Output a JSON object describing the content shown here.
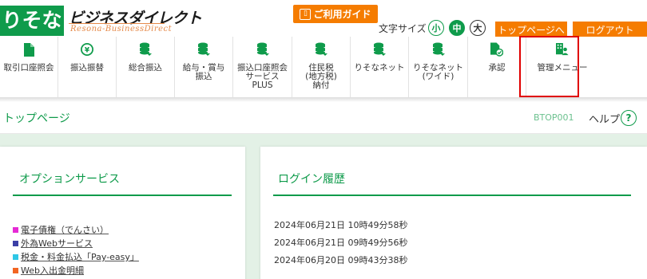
{
  "header": {
    "logo_main": "りそな",
    "logo_title": "ビジネスダイレクト",
    "logo_subtitle": "Resona-BusinessDirect",
    "guide_button": "ご利用ガイド",
    "font_size_label": "文字サイズ",
    "font_size_small": "小",
    "font_size_medium": "中",
    "font_size_large": "大",
    "top_page_button": "トップページへ",
    "logout_button": "ログアウト"
  },
  "menu": {
    "items": [
      {
        "label": "取引口座照会",
        "icon": "document-icon"
      },
      {
        "label": "振込振替",
        "icon": "yen-transfer-icon"
      },
      {
        "label": "総合振込",
        "icon": "coin-stack-arrow-icon"
      },
      {
        "label": "給与・賞与\n振込",
        "icon": "coin-stack-arrow-icon"
      },
      {
        "label": "振込口座照会\nサービス\nPLUS",
        "icon": "coin-stack-arrow-icon"
      },
      {
        "label": "住民税\n(地方税)\n納付",
        "icon": "coin-stack-arrow-icon"
      },
      {
        "label": "りそなネット",
        "icon": "coin-stack-arrow-icon"
      },
      {
        "label": "りそなネット\n(ワイド)",
        "icon": "coin-stack-arrow-icon"
      },
      {
        "label": "承認",
        "icon": "approve-document-icon"
      },
      {
        "label": "管理メニュー",
        "icon": "admin-user-icon"
      }
    ]
  },
  "page": {
    "title": "トップページ",
    "screen_id": "BTOP001",
    "help": "ヘルプ",
    "help_icon": "?"
  },
  "options": {
    "title": "オプションサービス",
    "items": [
      {
        "label": "電子債権（でんさい）",
        "color": "#e62ad5"
      },
      {
        "label": "外為Webサービス",
        "color": "#3b3fa6"
      },
      {
        "label": "税金・料金払込「Pay-easy」",
        "color": "#2fc7e6"
      },
      {
        "label": "Web入出金明細",
        "color": "#f26522"
      }
    ]
  },
  "login_history": {
    "title": "ログイン履歴",
    "entries": [
      "2024年06月21日 10時49分58秒",
      "2024年06月21日 09時49分56秒",
      "2024年06月20日 09時43分38秒"
    ]
  },
  "colors": {
    "brand_green": "#0f9b4b",
    "accent_orange": "#f57c00",
    "highlight_red": "#e00000",
    "content_bg": "#e3f1e6"
  }
}
